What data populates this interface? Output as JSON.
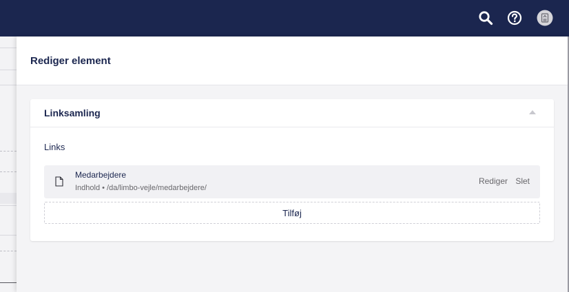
{
  "topbar": {
    "background": "#1b264f",
    "icons": [
      "search-icon",
      "help-icon",
      "avatar-icon"
    ]
  },
  "panel": {
    "title": "Rediger element"
  },
  "card": {
    "title": "Linksamling",
    "field_label": "Links",
    "items": [
      {
        "icon": "document-icon",
        "name": "Medarbejdere",
        "url": "Indhold • /da/limbo-vejle/medarbejdere/",
        "edit_label": "Rediger",
        "delete_label": "Slet"
      }
    ],
    "add_label": "Tilføj"
  },
  "colors": {
    "accent_text": "#1b264f",
    "muted_text": "#68676b",
    "panel_bg": "#f4f4f6"
  }
}
